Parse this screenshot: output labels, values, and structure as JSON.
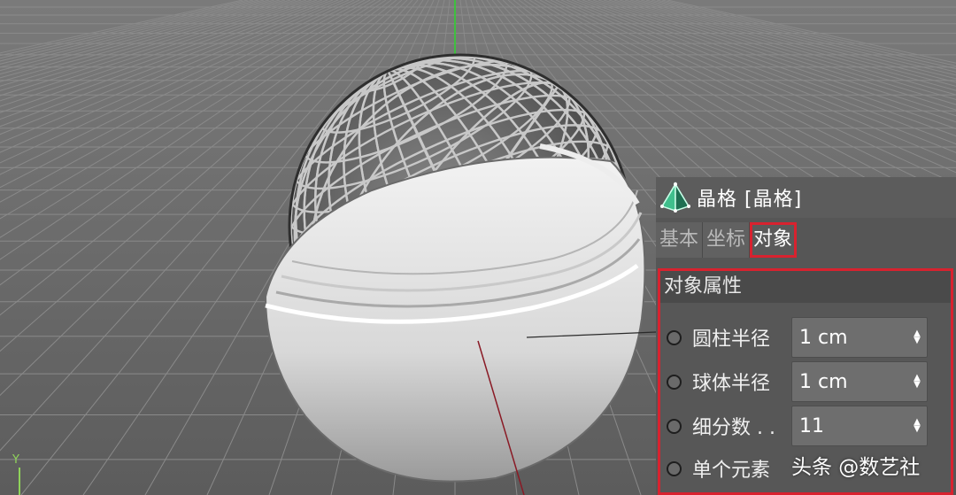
{
  "viewport": {
    "axis_label": "Y"
  },
  "object": {
    "title": "晶格 [晶格]",
    "icon": "lattice-pyramid-icon"
  },
  "tabs": [
    {
      "label": "基本",
      "active": false
    },
    {
      "label": "坐标",
      "active": false
    },
    {
      "label": "对象",
      "active": true
    }
  ],
  "section": {
    "title": "对象属性"
  },
  "properties": [
    {
      "label": "圆柱半径",
      "value": "1 cm"
    },
    {
      "label": "球体半径",
      "value": "1 cm"
    },
    {
      "label": "细分数 . .",
      "value": "11"
    },
    {
      "label": "单个元素",
      "value": ""
    }
  ],
  "watermark": "头条 @数艺社",
  "colors": {
    "highlight": "#d8222f",
    "panel_bg": "#565656",
    "axis_green": "#8fd35a"
  }
}
